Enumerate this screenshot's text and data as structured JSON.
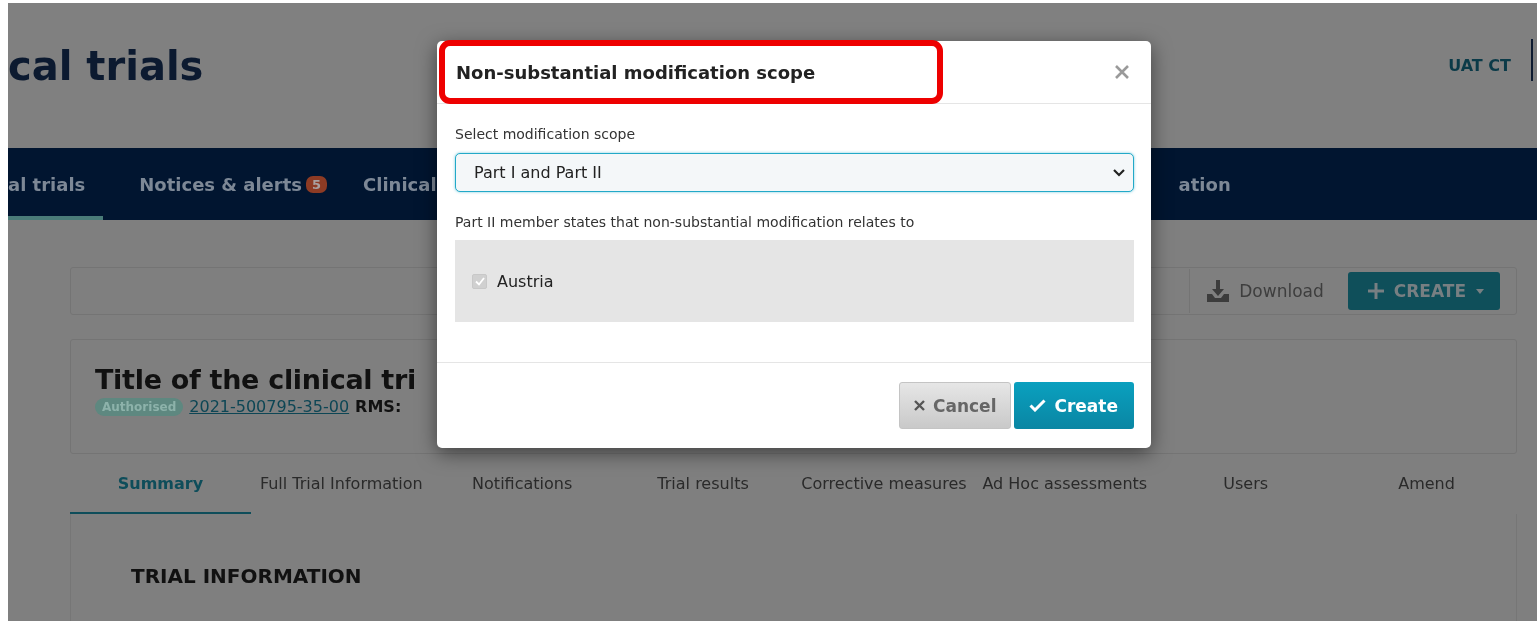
{
  "page": {
    "title": "cal trials",
    "user": "UAT CT"
  },
  "nav": [
    {
      "label": "al trials",
      "selected": true
    },
    {
      "label": "Notices & alerts",
      "badge": "5",
      "selected": false
    },
    {
      "label": "Clinical",
      "selected": false
    },
    {
      "label": "ation",
      "selected": false
    }
  ],
  "toolbar": [
    {
      "kind": "download",
      "label": "Download"
    },
    {
      "kind": "create",
      "label": "CREATE"
    }
  ],
  "trial": {
    "title": "Title of the clinical tri",
    "status": "Authorised",
    "number": "2021-500795-35-00",
    "rms_label": "RMS:"
  },
  "tabs": [
    {
      "label": "Summary",
      "selected": true
    },
    {
      "label": "Full Trial Information",
      "selected": false
    },
    {
      "label": "Notifications",
      "selected": false
    },
    {
      "label": "Trial results",
      "selected": false
    },
    {
      "label": "Corrective measures",
      "selected": false
    },
    {
      "label": "Ad Hoc assessments",
      "selected": false
    },
    {
      "label": "Users",
      "selected": false
    },
    {
      "label": "Amend",
      "selected": false
    }
  ],
  "section": {
    "heading": "TRIAL INFORMATION"
  },
  "dialog": {
    "title": "Non-substantial modification scope",
    "highlighted": true,
    "scope_label": "Select modification scope",
    "scope_value": "Part I and Part II",
    "states_label": "Part II member states that non-substantial modification relates to",
    "states": [
      {
        "label": "Austria",
        "checked": true,
        "disabled": true
      }
    ],
    "buttons": [
      {
        "kind": "cancel",
        "label": "Cancel"
      },
      {
        "kind": "confirm",
        "label": "Create"
      }
    ]
  }
}
